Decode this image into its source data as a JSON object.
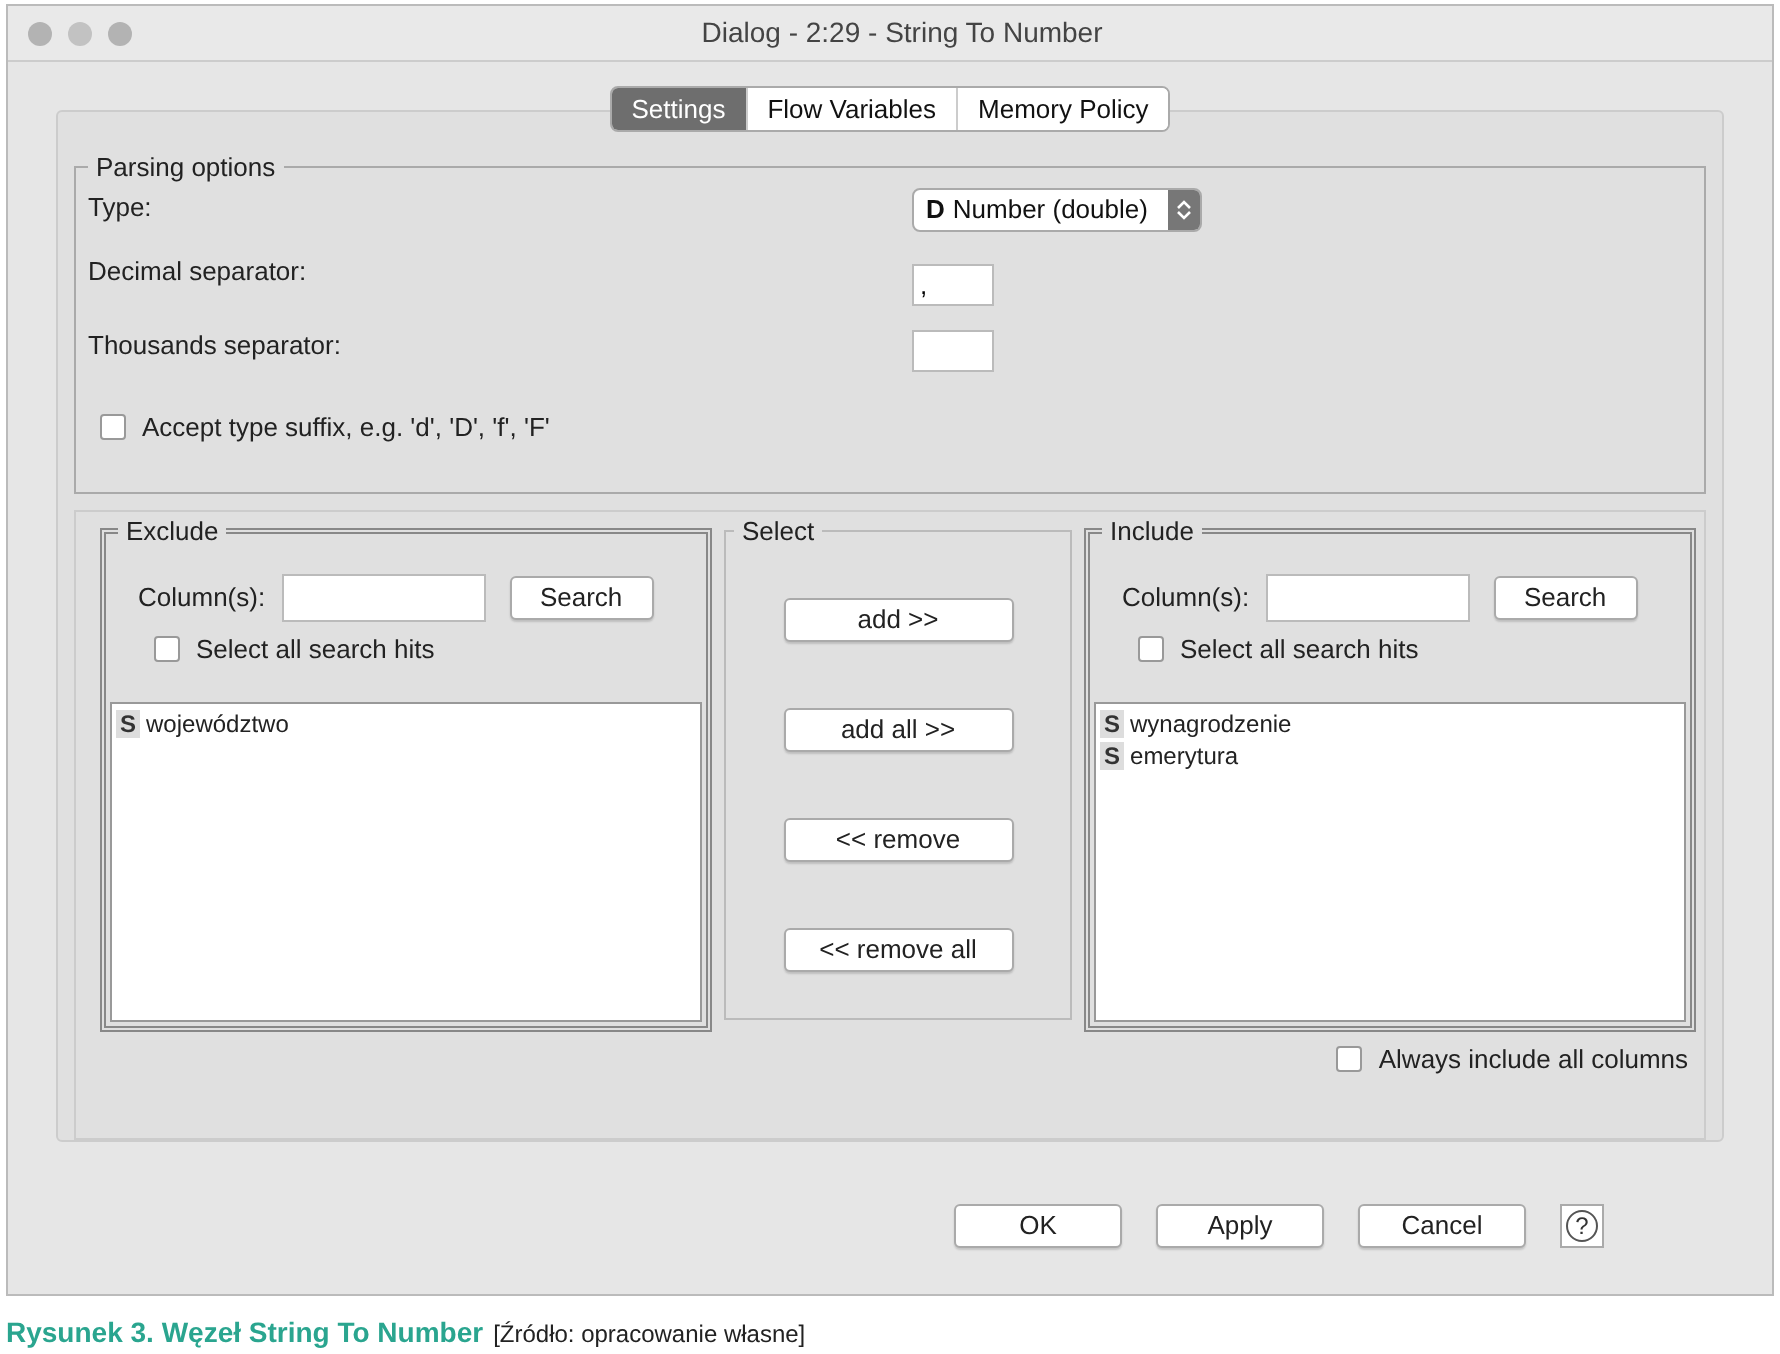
{
  "window": {
    "title": "Dialog - 2:29 - String To Number"
  },
  "tabs": [
    {
      "label": "Settings",
      "selected": true
    },
    {
      "label": "Flow Variables",
      "selected": false
    },
    {
      "label": "Memory Policy",
      "selected": false
    }
  ],
  "parsing_options": {
    "title": "Parsing options",
    "type": {
      "label": "Type:",
      "badge": "D",
      "value": "Number (double)"
    },
    "decimal_separator": {
      "label": "Decimal separator:",
      "value": ","
    },
    "thousands_separator": {
      "label": "Thousands separator:"
    },
    "accept_suffix": {
      "label": "Accept type suffix, e.g. 'd', 'D', 'f', 'F'",
      "checked": false
    }
  },
  "exclude": {
    "title": "Exclude",
    "search_label": "Column(s):",
    "search_button": "Search",
    "select_all": {
      "label": "Select all search hits",
      "checked": false
    },
    "items": [
      {
        "badge": "S",
        "name": "województwo"
      }
    ]
  },
  "select": {
    "title": "Select",
    "buttons": [
      "add >>",
      "add all >>",
      "<< remove",
      "<< remove all"
    ]
  },
  "include": {
    "title": "Include",
    "search_label": "Column(s):",
    "search_button": "Search",
    "select_all": {
      "label": "Select all search hits",
      "checked": false
    },
    "items": [
      {
        "badge": "S",
        "name": "wynagrodzenie"
      },
      {
        "badge": "S",
        "name": "emerytura"
      }
    ]
  },
  "always_include": {
    "label": "Always include all columns",
    "checked": false
  },
  "buttons": [
    "OK",
    "Apply",
    "Cancel"
  ],
  "help": "?",
  "caption": {
    "title": "Rysunek 3. Węzeł String To Number",
    "source": "[Źródło: opracowanie własne]"
  }
}
